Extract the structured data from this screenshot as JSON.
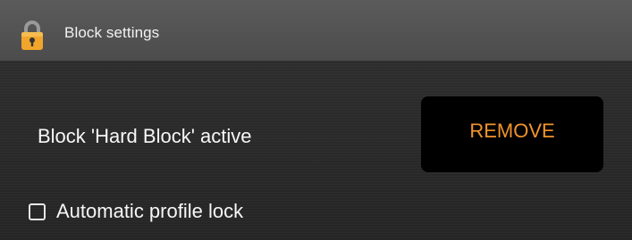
{
  "window": {
    "title": "Block settings",
    "icon": "lock-icon"
  },
  "block": {
    "status_text": "Block 'Hard Block' active",
    "remove_label": "REMOVE",
    "accent_color": "#f0942b"
  },
  "options": {
    "auto_lock_label": "Automatic profile lock",
    "auto_lock_checked": false
  }
}
